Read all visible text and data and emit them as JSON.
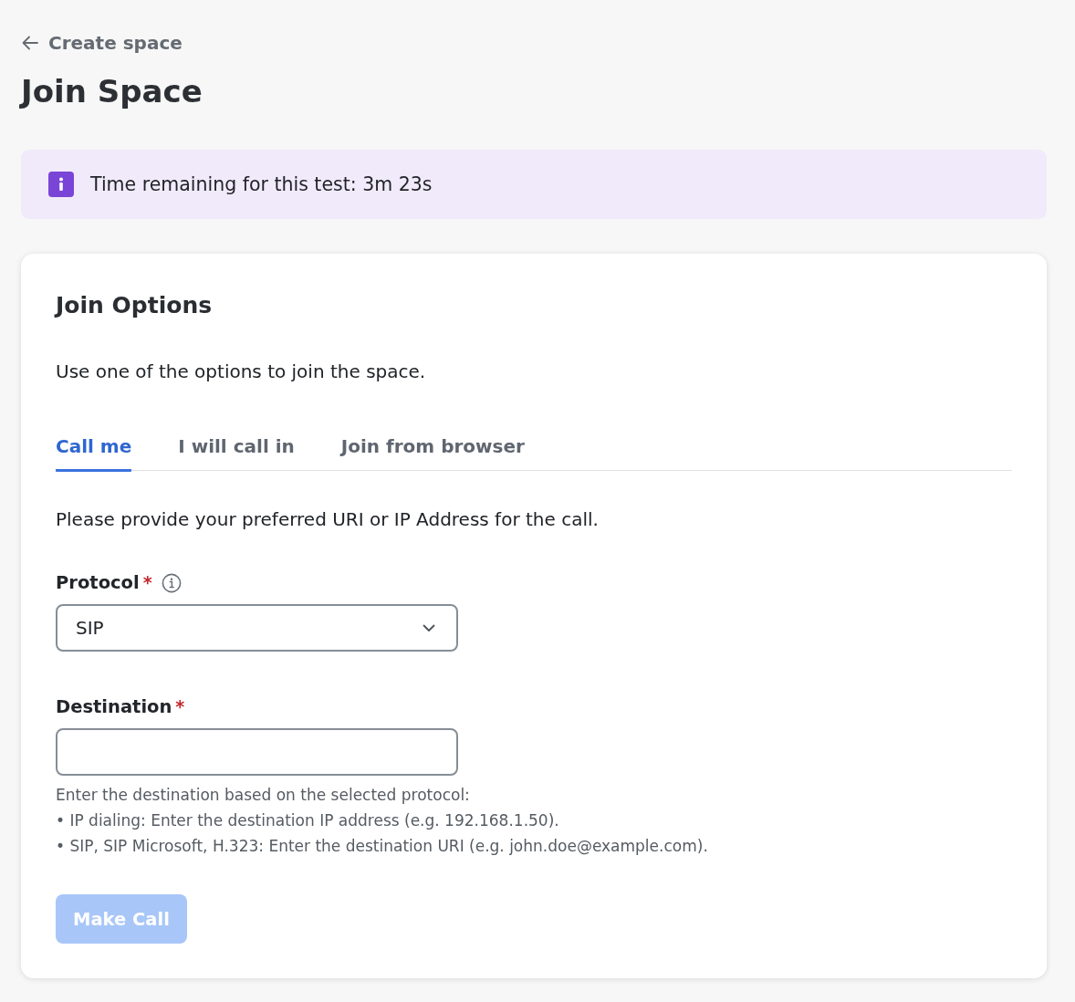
{
  "back_link": {
    "label": "Create space"
  },
  "title": "Join Space",
  "banner": {
    "kind": "info",
    "text": "Time remaining for this test: 3m 23s"
  },
  "card": {
    "title": "Join Options",
    "description": "Use one of the options to join the space.",
    "tabs": [
      {
        "label": "Call me",
        "selected": true
      },
      {
        "label": "I will call in",
        "selected": false
      },
      {
        "label": "Join from browser",
        "selected": false
      }
    ],
    "instructions": "Please provide your preferred URI or IP Address for the call.",
    "fields": [
      {
        "kind": "select",
        "label": "Protocol",
        "required_mark": "*",
        "info_tip": true,
        "value": "SIP"
      },
      {
        "kind": "text",
        "label": "Destination",
        "required_mark": "*",
        "info_tip": false,
        "hint": {
          "intro": "Enter the destination based on the selected protocol:",
          "items": [
            "• IP dialing: Enter the destination IP address (e.g. 192.168.1.50).",
            "• SIP, SIP Microsoft, H.323: Enter the destination URI (e.g. john.doe@example.com)."
          ]
        }
      }
    ],
    "button": {
      "label": "Make Call",
      "disabled": true
    }
  }
}
